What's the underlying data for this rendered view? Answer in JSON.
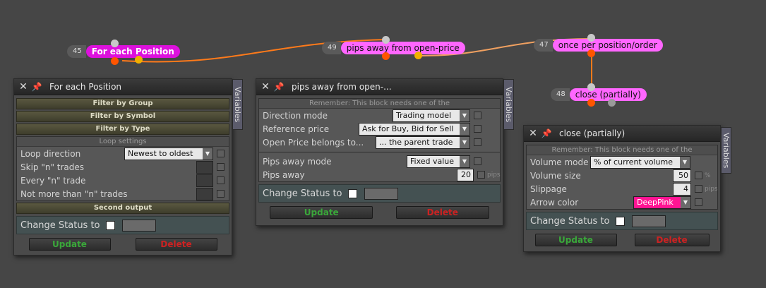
{
  "nodes": [
    {
      "id": "45",
      "label": "For each Position"
    },
    {
      "id": "49",
      "label": "pips away from open-price"
    },
    {
      "id": "47",
      "label": "once per position/order"
    },
    {
      "id": "48",
      "label": "close (partially)"
    }
  ],
  "colors": {
    "node_pink": "#ff66ff",
    "node_magenta": "#dd11dd",
    "link_main": "#ff7a1a",
    "link_secondary": "#f0a060",
    "update": "#3aa83a",
    "delete": "#cc2222"
  },
  "common": {
    "variables_tab": "Variables",
    "change_status": "Change Status to",
    "update": "Update",
    "delete": "Delete",
    "close_icon": "close-icon",
    "pin_icon": "pin-icon"
  },
  "panel1": {
    "title": "For each Position",
    "filter_group": "Filter by Group",
    "filter_symbol": "Filter by Symbol",
    "filter_type": "Filter by Type",
    "loop_settings": "Loop settings",
    "loop_direction_label": "Loop direction",
    "loop_direction_value": "Newest to oldest",
    "skip_label": "Skip \"n\" trades",
    "every_label": "Every \"n\" trade",
    "not_more_label": "Not more than \"n\" trades",
    "second_output": "Second output"
  },
  "panel2": {
    "title": "pips away from open-...",
    "remember": "Remember: This block needs one of the",
    "direction_label": "Direction mode",
    "direction_value": "Trading model",
    "reference_label": "Reference price",
    "reference_value": "Ask for Buy, Bid for Sell",
    "open_price_label": "Open Price belongs to...",
    "open_price_value": "... the parent trade",
    "pips_mode_label": "Pips away mode",
    "pips_mode_value": "Fixed value",
    "pips_away_label": "Pips away",
    "pips_away_value": "20",
    "pips_unit": "pips"
  },
  "panel3": {
    "title": "close (partially)",
    "remember": "Remember: This block needs one of the",
    "volume_mode_label": "Volume mode",
    "volume_mode_value": "% of current volume",
    "volume_size_label": "Volume size",
    "volume_size_value": "50",
    "volume_unit": "%",
    "slippage_label": "Slippage",
    "slippage_value": "4",
    "slippage_unit": "pips",
    "arrow_color_label": "Arrow color",
    "arrow_color_value": "DeepPink",
    "arrow_color_hex": "#ff1493"
  }
}
